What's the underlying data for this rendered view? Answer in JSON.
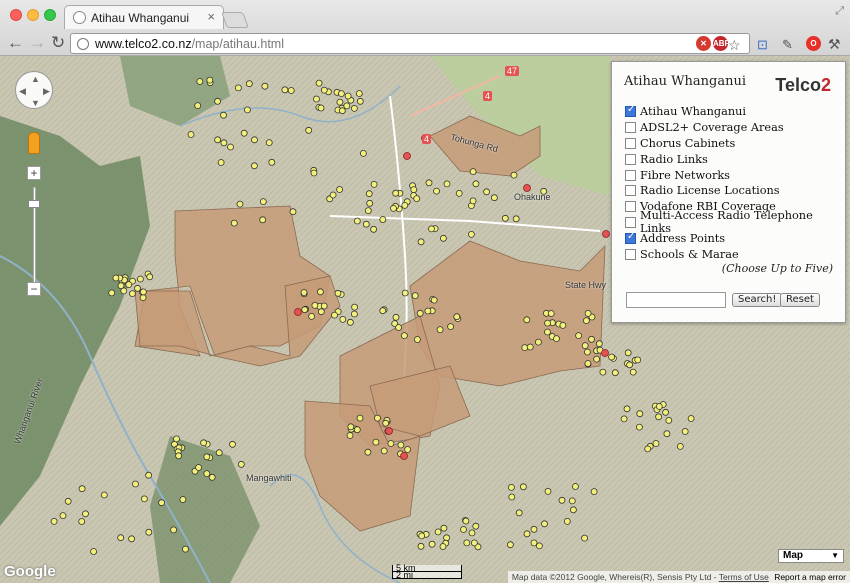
{
  "browser": {
    "tab_title": "Atihau Whanganui",
    "url_host": "www.telco2.co.nz",
    "url_path": "/map/atihau.html",
    "extensions": [
      {
        "name": "adblock-icon",
        "label": "✕",
        "color": "#d43a2f"
      },
      {
        "name": "abp-icon",
        "label": "ABP",
        "color": "#c1272d"
      },
      {
        "name": "opera-icon",
        "label": "O",
        "color": "#e8302a"
      }
    ]
  },
  "panel": {
    "title": "Atihau Whanganui",
    "logo_text": "Telco",
    "logo_suffix": "2",
    "layers": [
      {
        "label": "Atihau Whanganui",
        "checked": true
      },
      {
        "label": "ADSL2+ Coverage Areas",
        "checked": false
      },
      {
        "label": "Chorus Cabinets",
        "checked": false
      },
      {
        "label": "Radio Links",
        "checked": false
      },
      {
        "label": "Fibre Networks",
        "checked": false
      },
      {
        "label": "Radio License Locations",
        "checked": false
      },
      {
        "label": "Vodafone RBI Coverage",
        "checked": false
      },
      {
        "label": "Multi-Access Radio Telephone Links",
        "checked": false
      },
      {
        "label": "Address Points",
        "checked": true
      },
      {
        "label": "Schools & Marae",
        "checked": false
      }
    ],
    "hint": "(Choose Up to Five)",
    "search_value": "",
    "search_button": "Search!",
    "reset_button": "Reset"
  },
  "map": {
    "place_labels": [
      "Ohakune",
      "Mangawhiti",
      "Tohunga Rd",
      "Whanganui River",
      "State Hwy"
    ],
    "road_shields": [
      "4",
      "47",
      "4"
    ],
    "scale_km": "5 km",
    "scale_mi": "2 mi",
    "google_logo": "Google",
    "attribution": "Map data ©2012 Google, Whereis(R), Sensis Pty Ltd -",
    "terms_link": "Terms of Use",
    "report_link": "Report a map error",
    "map_type": "Map",
    "colors": {
      "terrain": "#c9c6b2",
      "forest": "#6f8a63",
      "parcel": "#c59b78",
      "address_point": "#f2f07a",
      "river": "#8fb2c9"
    }
  }
}
